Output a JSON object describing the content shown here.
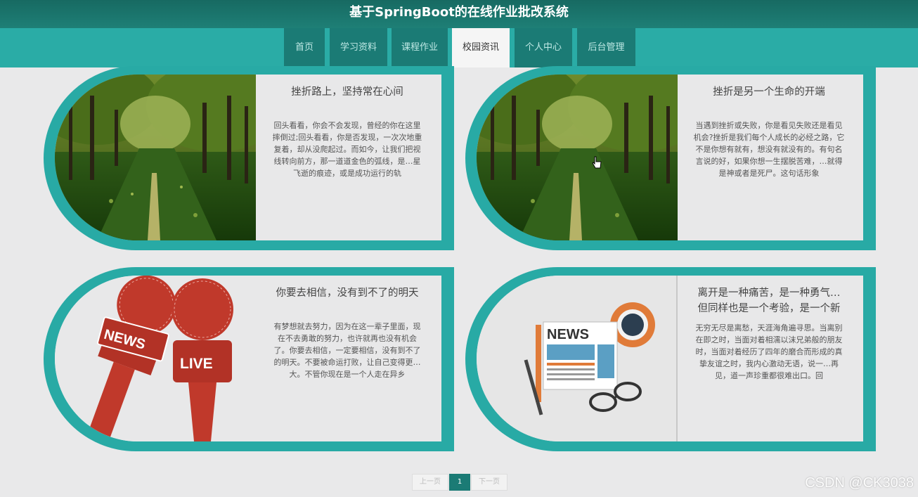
{
  "header": {
    "title": "基于SpringBoot的在线作业批改系统"
  },
  "nav": {
    "items": [
      {
        "label": "首页"
      },
      {
        "label": "学习资料"
      },
      {
        "label": "课程作业"
      },
      {
        "label": "校园资讯",
        "active": true
      },
      {
        "label": "个人中心"
      },
      {
        "label": "后台管理"
      }
    ]
  },
  "cards": [
    {
      "title": "挫折路上，坚持常在心间",
      "body": "回头看看，你会不会发现，曾经的你在这里摔倒过;回头看看，你是否发现，一次次地重复着，却从没爬起过。而如今，让我们把视线转向前方，那一道道金色的弧线，是…星飞逝的痕迹，或是成功运行的轨",
      "image": "tree-lined-road"
    },
    {
      "title": "挫折是另一个生命的开端",
      "body": "当遇到挫折或失败，你是看见失败还是看见机会?挫折是我们每个人成长的必经之路，它不是你想有就有，想没有就没有的。有句名言说的好，如果你想一生摆脱苦难，…就得是神或者是死尸。这句话形象",
      "image": "tree-lined-road"
    },
    {
      "title": "你要去相信，没有到不了的明天",
      "body": "有梦想就去努力，因为在这一辈子里面，现在不去勇敢的努力，也许就再也没有机会了。你要去相信，一定要相信，没有到不了的明天。不要被命运打败，让自己变得更…大。不管你现在是一个人走在异乡",
      "image": "news-live-microphones",
      "img_text": {
        "news": "NEWS",
        "live": "LIVE"
      }
    },
    {
      "title": "离开是一种痛苦，是一种勇气…但同样也是一个考验，是一个新",
      "body": "无穷无尽是离愁，天涯海角遍寻思。当离别在即之时，当面对着相濡以沫兄弟般的朋友时，当面对着经历了四年的磨合而形成的真挚友谊之时，我内心激动无语，说一…再见，道一声珍重都很难出口。回",
      "image": "newspaper-coffee-glasses",
      "img_text": {
        "news": "NEWS"
      }
    }
  ],
  "pagination": {
    "prev": "上一页",
    "current": "1",
    "next": "下一页"
  },
  "watermark": "CSDN @CK3038",
  "colors": {
    "teal": "#28aaa5",
    "dark_teal": "#1b7b75",
    "header": "#176a62"
  }
}
